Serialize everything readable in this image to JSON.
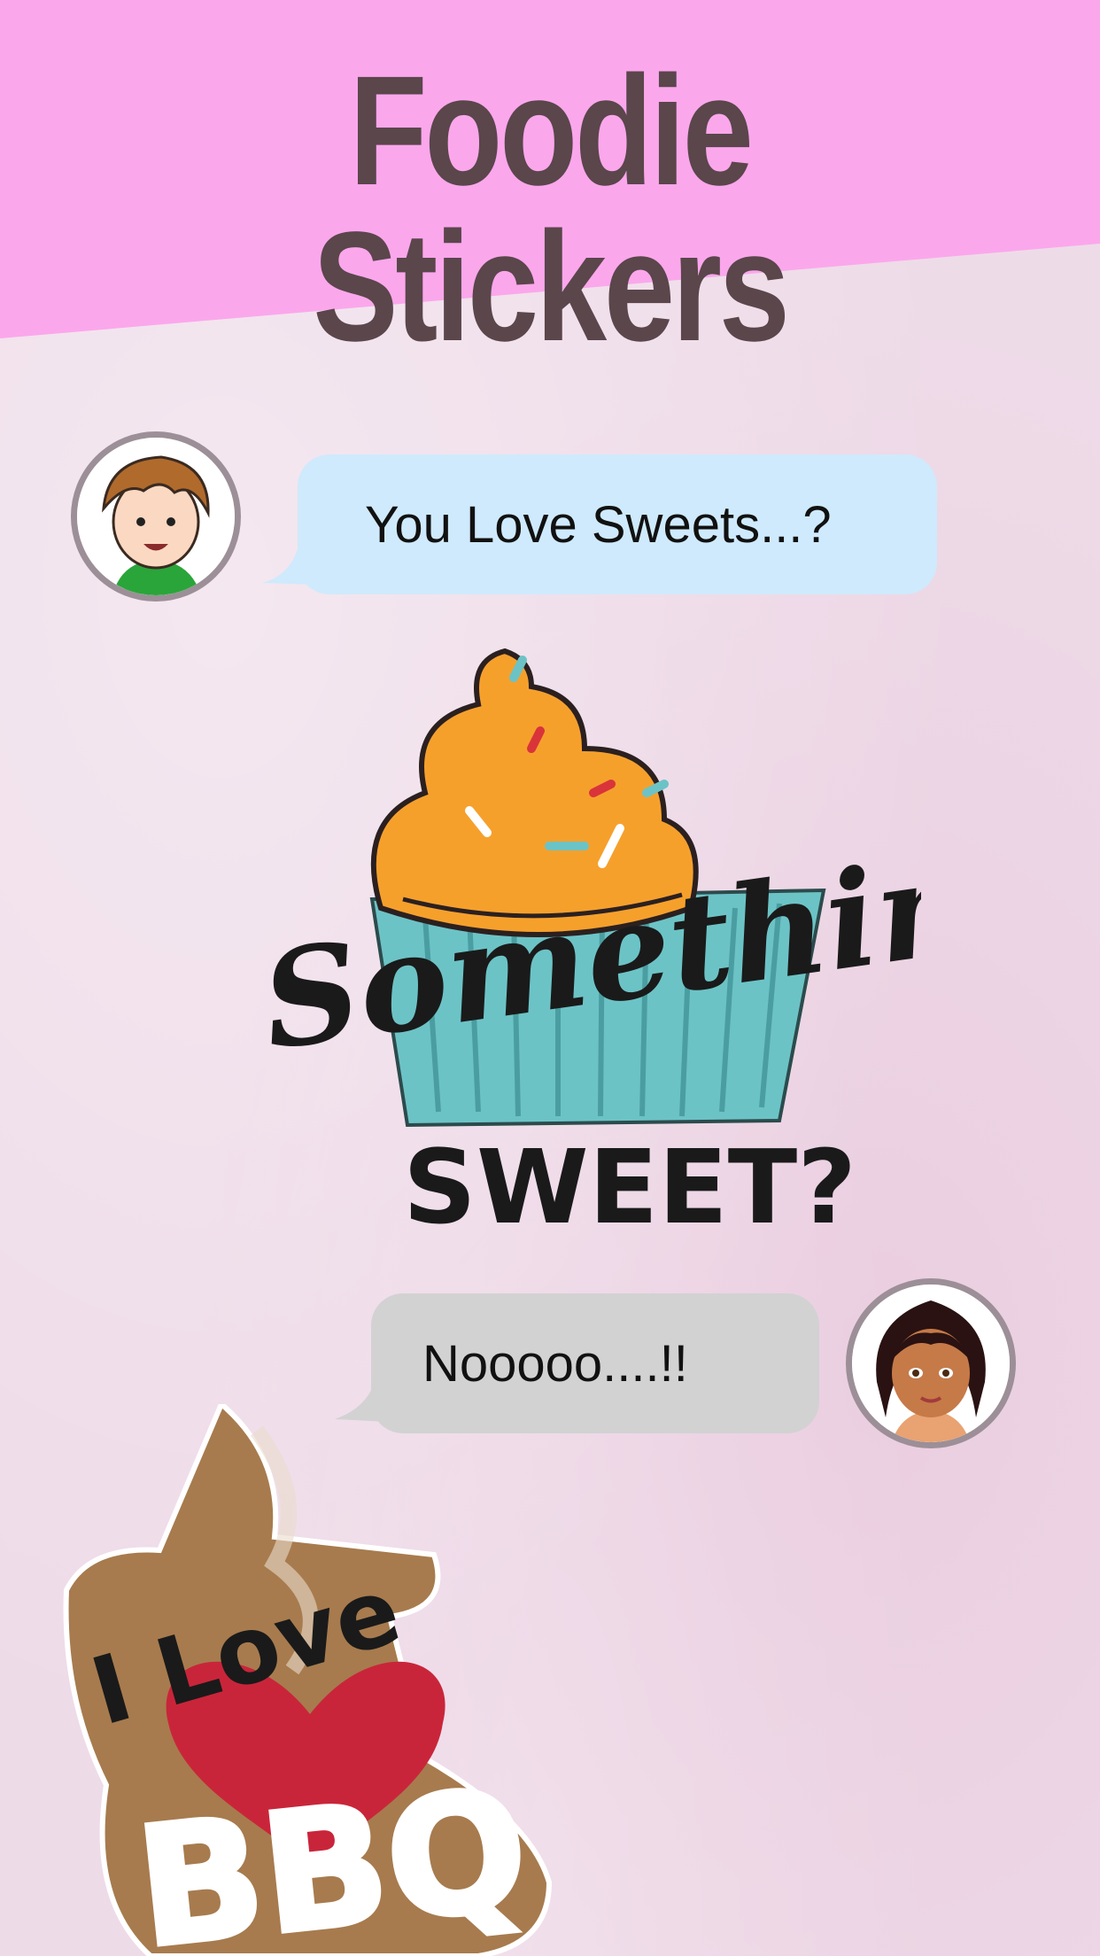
{
  "header": {
    "title": "Foodie Stickers",
    "background_color": "#fba7ec",
    "title_color": "#5a464b"
  },
  "chat": [
    {
      "sender": "boy",
      "text": "You Love Sweets...?",
      "bubble_color": "#cfeafc"
    },
    {
      "sender": "girl",
      "text": "Nooooo....!!",
      "bubble_color": "#d2d2d2"
    }
  ],
  "stickers": [
    {
      "name": "cupcake-sticker",
      "text": [
        "Something",
        "SWEET?"
      ]
    },
    {
      "name": "bbq-sticker",
      "text": [
        "I Love",
        "BBQ"
      ]
    }
  ],
  "icons": [
    "boy-avatar-icon",
    "girl-avatar-icon",
    "cupcake-icon",
    "heart-icon"
  ]
}
